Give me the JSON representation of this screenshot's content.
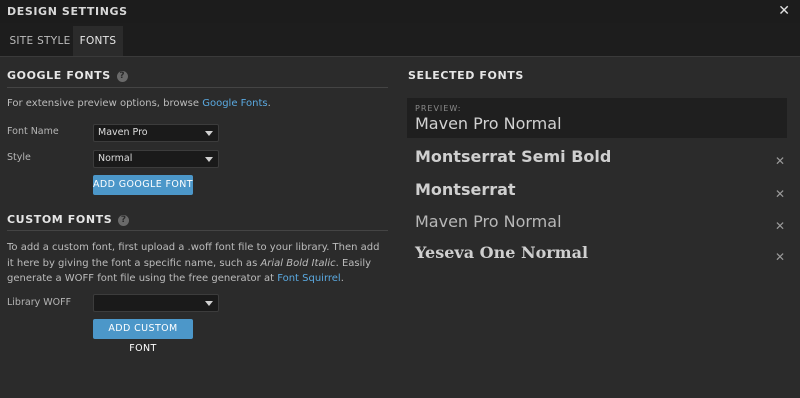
{
  "window": {
    "title": "DESIGN SETTINGS",
    "close_glyph": "✕"
  },
  "tabs": [
    {
      "label": "SITE STYLE",
      "active": false
    },
    {
      "label": "FONTS",
      "active": true
    }
  ],
  "google_fonts": {
    "title": "GOOGLE FONTS",
    "help_glyph": "?",
    "intro_text": "For extensive preview options, browse ",
    "intro_link": "Google Fonts",
    "intro_end": ".",
    "font_name_label": "Font Name",
    "font_name_value": "Maven Pro",
    "style_label": "Style",
    "style_value": "Normal",
    "add_button": "ADD GOOGLE FONT"
  },
  "custom_fonts": {
    "title": "CUSTOM FONTS",
    "help_glyph": "?",
    "text_1": "To add a custom font, first upload a .woff font file to your library. Then add it here by giving the font a specific name, such as ",
    "text_italic": "Arial Bold Italic",
    "text_2": ". Easily generate a WOFF font file using the free generator at ",
    "text_link": "Font Squirrel",
    "text_end": ".",
    "library_label": "Library WOFF",
    "library_value": "",
    "add_button": "ADD CUSTOM FONT"
  },
  "selected_fonts": {
    "title": "SELECTED FONTS",
    "preview_label": "PREVIEW:",
    "preview_text": "Maven Pro Normal",
    "remove_glyph": "✕",
    "items": [
      {
        "name": "Montserrat Semi Bold"
      },
      {
        "name": "Montserrat"
      },
      {
        "name": "Maven Pro Normal"
      },
      {
        "name": "Yeseva One Normal"
      }
    ]
  }
}
